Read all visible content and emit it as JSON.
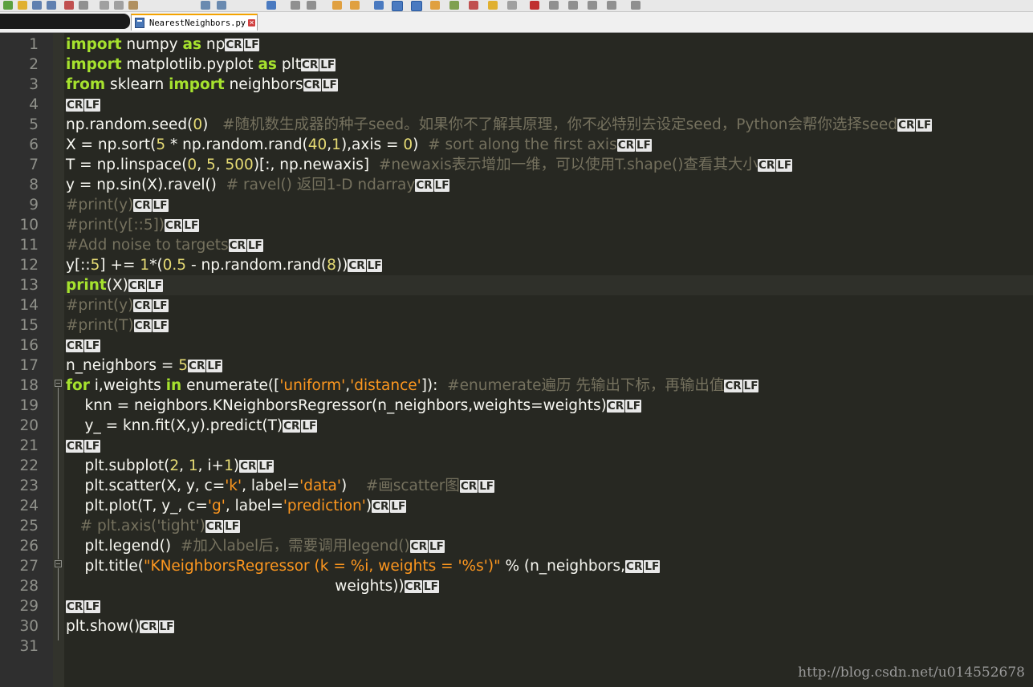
{
  "window": {
    "tab_title": "NearestNeighbors.py"
  },
  "icons": {
    "file": "python-file-icon",
    "close": "close-tab-icon"
  },
  "colors": {
    "background": "#272822",
    "keyword": "#a6e22e",
    "number": "#e6db74",
    "string": "#fd971f",
    "comment": "#75715e",
    "text": "#f8f8f2"
  },
  "editor": {
    "eol_marker": {
      "cr": "CR",
      "lf": "LF"
    },
    "current_line": 13,
    "lines": [
      {
        "n": "1",
        "parts": [
          [
            "kw",
            "import"
          ],
          [
            "t",
            " numpy "
          ],
          [
            "kw",
            "as"
          ],
          [
            "t",
            " np"
          ]
        ]
      },
      {
        "n": "2",
        "parts": [
          [
            "kw",
            "import"
          ],
          [
            "t",
            " matplotlib.pyplot "
          ],
          [
            "kw",
            "as"
          ],
          [
            "t",
            " plt"
          ]
        ]
      },
      {
        "n": "3",
        "parts": [
          [
            "kw",
            "from"
          ],
          [
            "t",
            " sklearn "
          ],
          [
            "kw",
            "import"
          ],
          [
            "t",
            " neighbors"
          ]
        ]
      },
      {
        "n": "4",
        "parts": []
      },
      {
        "n": "5",
        "parts": [
          [
            "t",
            "np.random.seed("
          ],
          [
            "num",
            "0"
          ],
          [
            "t",
            ")  "
          ],
          [
            "cm",
            " #随机数生成器的种子seed。如果你不了解其原理，你不必特别去设定seed，Python会帮你选择seed"
          ]
        ]
      },
      {
        "n": "6",
        "parts": [
          [
            "t",
            "X = np.sort("
          ],
          [
            "num",
            "5"
          ],
          [
            "t",
            " * np.random.rand("
          ],
          [
            "num",
            "40"
          ],
          [
            "t",
            ","
          ],
          [
            "num",
            "1"
          ],
          [
            "t",
            "),axis = "
          ],
          [
            "num",
            "0"
          ],
          [
            "t",
            ")  "
          ],
          [
            "cm",
            "# sort along the first axis"
          ]
        ]
      },
      {
        "n": "7",
        "parts": [
          [
            "t",
            "T = np.linspace("
          ],
          [
            "num",
            "0"
          ],
          [
            "t",
            ", "
          ],
          [
            "num",
            "5"
          ],
          [
            "t",
            ", "
          ],
          [
            "num",
            "500"
          ],
          [
            "t",
            ")[:, np.newaxis]  "
          ],
          [
            "cm",
            "#newaxis表示增加一维，可以使用T.shape()查看其大小"
          ]
        ]
      },
      {
        "n": "8",
        "parts": [
          [
            "t",
            "y = np.sin(X).ravel()  "
          ],
          [
            "cm",
            "# ravel() 返回1-D ndarray"
          ]
        ]
      },
      {
        "n": "9",
        "parts": [
          [
            "cm",
            "#print(y)"
          ]
        ]
      },
      {
        "n": "10",
        "parts": [
          [
            "cm",
            "#print(y[::5])"
          ]
        ]
      },
      {
        "n": "11",
        "parts": [
          [
            "cm",
            "#Add noise to targets"
          ]
        ]
      },
      {
        "n": "12",
        "parts": [
          [
            "t",
            "y[::"
          ],
          [
            "num",
            "5"
          ],
          [
            "t",
            "] += "
          ],
          [
            "num",
            "1"
          ],
          [
            "t",
            "*("
          ],
          [
            "num",
            "0.5"
          ],
          [
            "t",
            " - np.random.rand("
          ],
          [
            "num",
            "8"
          ],
          [
            "t",
            "))"
          ]
        ]
      },
      {
        "n": "13",
        "parts": [
          [
            "kw",
            "print"
          ],
          [
            "t",
            "(X)"
          ]
        ]
      },
      {
        "n": "14",
        "parts": [
          [
            "cm",
            "#print(y)"
          ]
        ]
      },
      {
        "n": "15",
        "parts": [
          [
            "cm",
            "#print(T)"
          ]
        ]
      },
      {
        "n": "16",
        "parts": []
      },
      {
        "n": "17",
        "parts": [
          [
            "t",
            "n_neighbors = "
          ],
          [
            "num",
            "5"
          ]
        ]
      },
      {
        "n": "18",
        "parts": [
          [
            "kw",
            "for"
          ],
          [
            "t",
            " i,weights "
          ],
          [
            "kw",
            "in"
          ],
          [
            "t",
            " enumerate(["
          ],
          [
            "str",
            "'uniform'"
          ],
          [
            "t",
            ","
          ],
          [
            "str",
            "'distance'"
          ],
          [
            "t",
            "]):  "
          ],
          [
            "cm",
            "#enumerate遍历 先输出下标，再输出值"
          ]
        ]
      },
      {
        "n": "19",
        "parts": [
          [
            "t",
            "    knn = neighbors.KNeighborsRegressor(n_neighbors,weights=weights)"
          ]
        ]
      },
      {
        "n": "20",
        "parts": [
          [
            "t",
            "    y_ = knn.fit(X,y).predict(T)"
          ]
        ]
      },
      {
        "n": "21",
        "parts": []
      },
      {
        "n": "22",
        "parts": [
          [
            "t",
            "    plt.subplot("
          ],
          [
            "num",
            "2"
          ],
          [
            "t",
            ", "
          ],
          [
            "num",
            "1"
          ],
          [
            "t",
            ", i+"
          ],
          [
            "num",
            "1"
          ],
          [
            "t",
            ")"
          ]
        ]
      },
      {
        "n": "23",
        "parts": [
          [
            "t",
            "    plt.scatter(X, y, c="
          ],
          [
            "str",
            "'k'"
          ],
          [
            "t",
            ", label="
          ],
          [
            "str",
            "'data'"
          ],
          [
            "t",
            ")    "
          ],
          [
            "cm",
            "#画scatter图"
          ]
        ]
      },
      {
        "n": "24",
        "parts": [
          [
            "t",
            "    plt.plot(T, y_, c="
          ],
          [
            "str",
            "'g'"
          ],
          [
            "t",
            ", label="
          ],
          [
            "str",
            "'prediction'"
          ],
          [
            "t",
            ")"
          ]
        ]
      },
      {
        "n": "25",
        "parts": [
          [
            "t",
            "   "
          ],
          [
            "cm",
            "# plt.axis('tight')"
          ]
        ]
      },
      {
        "n": "26",
        "parts": [
          [
            "t",
            "    plt.legend()  "
          ],
          [
            "cm",
            "#加入label后，需要调用legend()"
          ]
        ]
      },
      {
        "n": "27",
        "parts": [
          [
            "t",
            "    plt.title("
          ],
          [
            "str",
            "\"KNeighborsRegressor (k = %i, weights = '%s')\""
          ],
          [
            "t",
            " % (n_neighbors,"
          ]
        ]
      },
      {
        "n": "28",
        "parts": [
          [
            "t",
            "                                                         weights))"
          ]
        ]
      },
      {
        "n": "29",
        "parts": []
      },
      {
        "n": "30",
        "parts": [
          [
            "t",
            "plt.show()"
          ]
        ]
      },
      {
        "n": "31",
        "parts": [],
        "no_eol": true
      }
    ]
  },
  "watermark": "http://blog.csdn.net/u014552678"
}
